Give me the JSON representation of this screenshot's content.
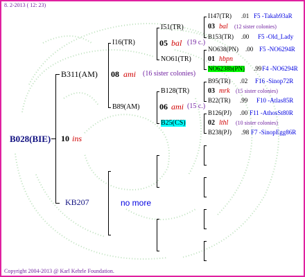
{
  "header": {
    "date": "8.  2-2013 ( 12: 23)"
  },
  "footer": {
    "copyright": "Copyright 2004-2013 @ Karl Kehrle Foundation."
  },
  "root": {
    "name": "B028(BIE)",
    "num": "10",
    "tag": "ins"
  },
  "l1": {
    "top": {
      "name": "B311(AM)",
      "num": "08",
      "tag": "ami",
      "sisters": "(16 sister colonies)"
    },
    "bottom": {
      "name": "KB207",
      "note": "no more"
    }
  },
  "l2": {
    "a": {
      "name": "I16(TR)",
      "num": "05",
      "tag": "bal",
      "sisters": "(19 c.)"
    },
    "b": {
      "name": "B89(AM)",
      "num": "06",
      "tag": "ami",
      "sisters": "(15 c.)"
    }
  },
  "l3": {
    "a": {
      "name": "I51(TR)"
    },
    "b": {
      "name": "NO61(TR)",
      "num": "01",
      "tag": "hbpn"
    },
    "c": {
      "name": "B128(TR)",
      "num": "03",
      "tag": "mrk",
      "sisters": "(15 sister colonies)"
    },
    "d": {
      "name": "B25(CS)",
      "num": "02",
      "tag": "lthl",
      "sisters": "(10 sister colonies)"
    }
  },
  "l4": {
    "a1": {
      "name": "I147(TR)",
      "val": ".01",
      "f": "F5 -Takab93aR"
    },
    "a_mid": {
      "num": "03",
      "tag": "bal",
      "sisters": "(12 sister colonies)"
    },
    "a2": {
      "name": "B153(TR)",
      "val": ".00",
      "f": "F5 -Old_Lady"
    },
    "b1": {
      "name": "NO638(PN)",
      "val": ".00",
      "f": "F5 -NO6294R"
    },
    "b2": {
      "name": "NO6238b(PN)",
      "val": ".99",
      "f": "F4 -NO6294R"
    },
    "c1": {
      "name": "B95(TR)",
      "val": ".02",
      "f": "F16 -Sinop72R"
    },
    "c2": {
      "name": "B22(TR)",
      "val": ".99",
      "f": "F10 -Atlas85R"
    },
    "d1": {
      "name": "B126(PJ)",
      "val": ".00",
      "f": "F11 -AthosSt80R"
    },
    "d2": {
      "name": "B238(PJ)",
      "val": ".98",
      "f": "F7 -SinopEgg86R"
    }
  }
}
